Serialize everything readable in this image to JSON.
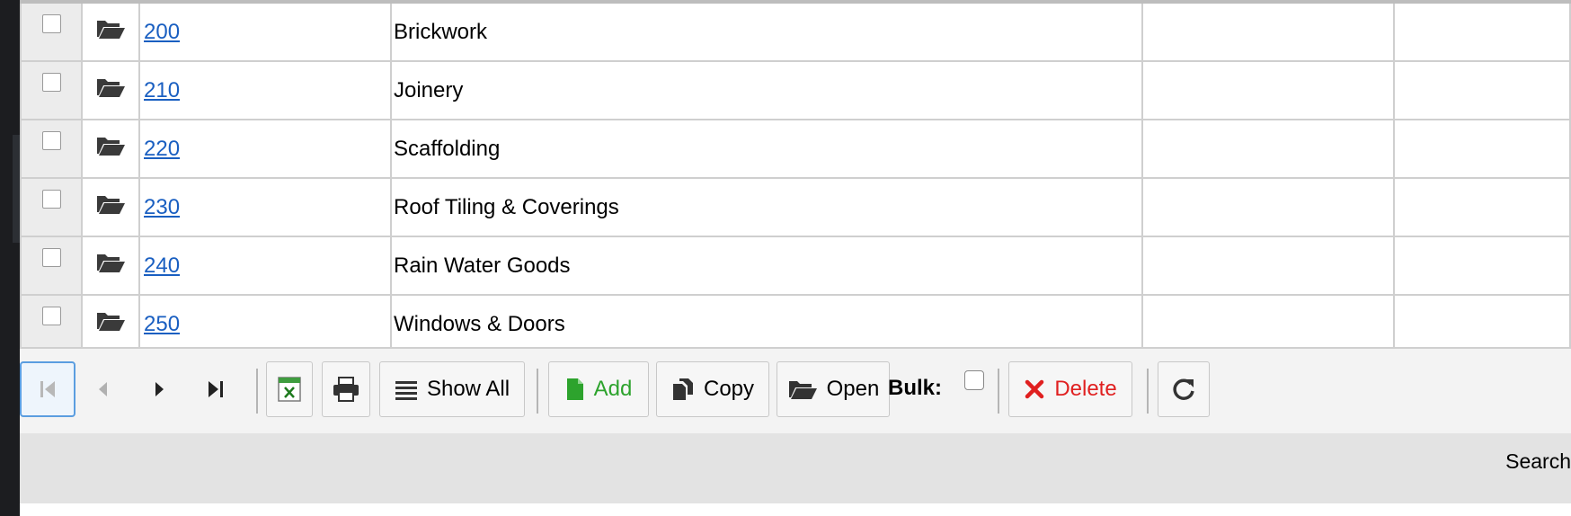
{
  "rows": [
    {
      "code": "200",
      "description": "Brickwork"
    },
    {
      "code": "210",
      "description": "Joinery"
    },
    {
      "code": "220",
      "description": "Scaffolding"
    },
    {
      "code": "230",
      "description": "Roof Tiling & Coverings"
    },
    {
      "code": "240",
      "description": "Rain Water Goods"
    },
    {
      "code": "250",
      "description": "Windows & Doors"
    }
  ],
  "toolbar": {
    "show_all_label": "Show All",
    "add_label": "Add",
    "copy_label": "Copy",
    "open_label": "Open",
    "bulk_label": "Bulk:",
    "delete_label": "Delete",
    "add_color": "#2da32d",
    "delete_color": "#e02020"
  },
  "search": {
    "label": "Search"
  },
  "icons": {
    "row_icon": "folder-open-icon",
    "nav": [
      "first-page-icon",
      "prev-page-icon",
      "next-page-icon",
      "last-page-icon"
    ],
    "export": "excel-icon",
    "print": "printer-icon",
    "refresh": "refresh-icon"
  }
}
